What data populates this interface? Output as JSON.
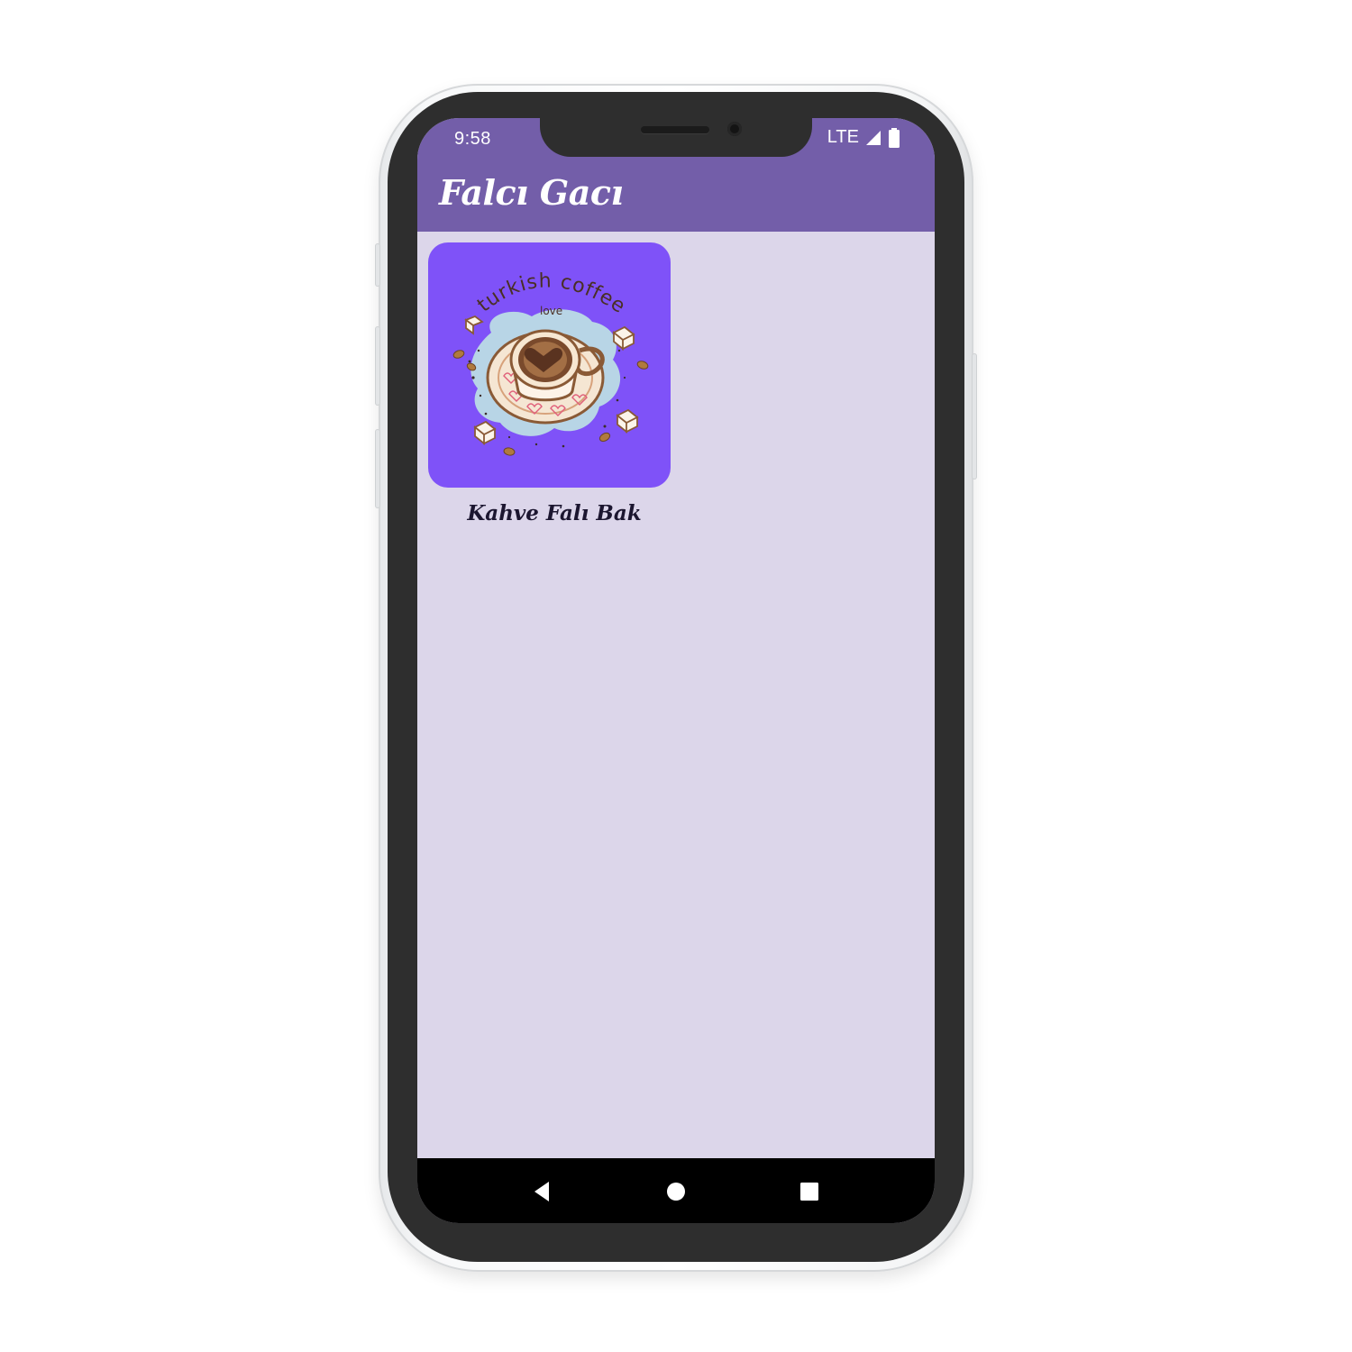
{
  "status_bar": {
    "time": "9:58",
    "network": "LTE",
    "icons": [
      "signal-icon",
      "battery-icon"
    ]
  },
  "app_bar": {
    "title": "Falcı Gacı"
  },
  "main": {
    "cards": [
      {
        "label": "Kahve Falı Bak",
        "image_text_top": "turkish coffee",
        "image_text_sub": "love",
        "icon": "turkish-coffee-illustration"
      }
    ]
  },
  "nav_bar": {
    "buttons": [
      "back-icon",
      "home-icon",
      "recents-icon"
    ]
  },
  "colors": {
    "app_bar": "#735ea9",
    "screen_background": "#dcd6ea",
    "card_background": "#7f52f8",
    "nav_bar": "#000000"
  }
}
